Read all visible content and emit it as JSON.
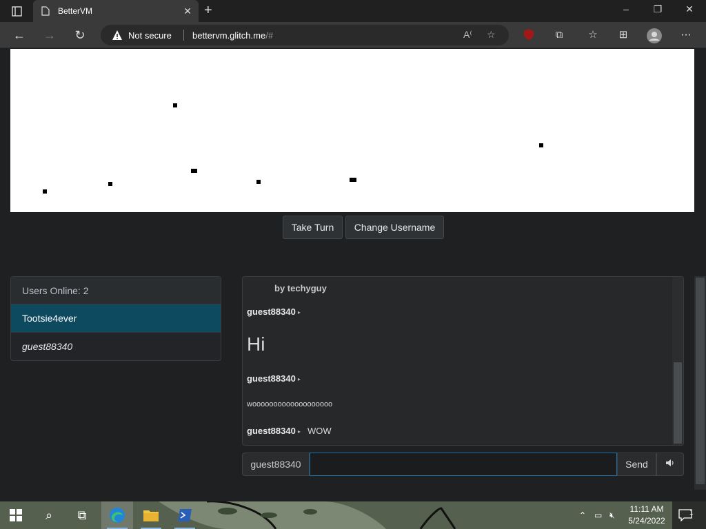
{
  "browser": {
    "tab_title": "BetterVM",
    "security_label": "Not secure",
    "url_host": "bettervm.glitch.me",
    "url_path": "/#"
  },
  "controls": {
    "take_turn_label": "Take Turn",
    "change_username_label": "Change Username"
  },
  "users": {
    "header": "Users Online: 2",
    "list": [
      "Tootsie4ever",
      "guest88340"
    ]
  },
  "chat": {
    "system_line": "by techyguy",
    "messages": [
      {
        "user": "guest88340",
        "text": "Hi"
      },
      {
        "user": "guest88340",
        "text": "wooooooooooooooooooo"
      },
      {
        "user": "guest88340",
        "text": "WOW"
      }
    ]
  },
  "chat_input": {
    "username": "guest88340",
    "value": "",
    "send_label": "Send",
    "volume_icon": "speaker-icon"
  },
  "taskbar": {
    "time": "11:11 AM",
    "date": "5/24/2022",
    "notification_count": "1"
  },
  "colors": {
    "page_bg": "#1e2022",
    "active_user_bg": "#0e4a5f",
    "input_focus": "#1f6fa8"
  }
}
